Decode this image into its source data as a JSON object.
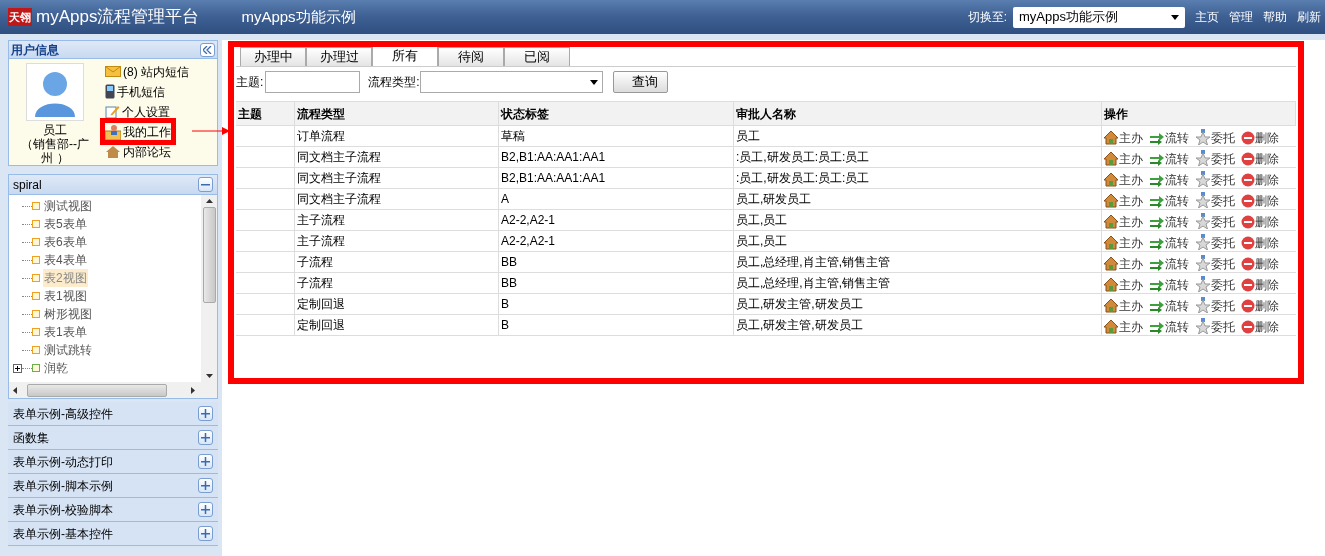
{
  "header": {
    "logo_mark": "天翎",
    "app_title": "myApps流程管理平台",
    "module_title": "myApps功能示例",
    "switch_label": "切换至:",
    "switch_value": "myApps功能示例",
    "links": [
      "主页",
      "管理",
      "帮助",
      "刷新"
    ]
  },
  "user_panel": {
    "title": "用户信息",
    "user_name": "员工",
    "user_dept": "（销售部--广州 ）",
    "links": [
      {
        "text": "(8) 站内短信",
        "kind": "mail",
        "highlighted": false
      },
      {
        "text": "手机短信",
        "kind": "phone",
        "highlighted": false
      },
      {
        "text": "个人设置",
        "kind": "settings",
        "highlighted": false
      },
      {
        "text": "我的工作",
        "kind": "work",
        "highlighted": true
      },
      {
        "text": "内部论坛",
        "kind": "forum",
        "highlighted": false
      }
    ]
  },
  "tree_panel": {
    "title": "spiral",
    "expanded": true,
    "items": [
      {
        "label": "测试视图",
        "selected": false
      },
      {
        "label": "表5表单",
        "selected": false
      },
      {
        "label": "表6表单",
        "selected": false
      },
      {
        "label": "表4表单",
        "selected": false
      },
      {
        "label": "表2视图",
        "selected": true
      },
      {
        "label": "表1视图",
        "selected": false
      },
      {
        "label": "树形视图",
        "selected": false
      },
      {
        "label": "表1表单",
        "selected": false
      },
      {
        "label": "测试跳转",
        "selected": false
      },
      {
        "label": "润乾",
        "selected": false,
        "expanded": false,
        "kind": "folder"
      }
    ]
  },
  "accordion": [
    {
      "title": "表单示例-高级控件",
      "expanded": false
    },
    {
      "title": "函数集",
      "expanded": false
    },
    {
      "title": "表单示例-动态打印",
      "expanded": false
    },
    {
      "title": "表单示例-脚本示例",
      "expanded": false
    },
    {
      "title": "表单示例-校验脚本",
      "expanded": false
    },
    {
      "title": "表单示例-基本控件",
      "expanded": false
    }
  ],
  "tabs": [
    {
      "label": "办理中",
      "selected": false
    },
    {
      "label": "办理过",
      "selected": false
    },
    {
      "label": "所有",
      "selected": true
    },
    {
      "label": "待阅",
      "selected": false
    },
    {
      "label": "已阅",
      "selected": false
    }
  ],
  "search": {
    "subject_label": "主题:",
    "type_label": "流程类型:",
    "button": "查询"
  },
  "table": {
    "columns": [
      "主题",
      "流程类型",
      "状态标签",
      "审批人名称",
      "操作"
    ],
    "rows": [
      {
        "type": "订单流程",
        "status": "草稿",
        "approvers": "员工",
        "actions": [
          {
            "label": "主办",
            "kind": "host"
          },
          {
            "label": "流转",
            "kind": "transfer"
          },
          {
            "label": "委托",
            "kind": "delegate"
          },
          {
            "label": "删除",
            "kind": "delete"
          }
        ]
      },
      {
        "type": "同文档主子流程",
        "status": "B2,B1:AA:AA1:AA1",
        "approvers": ":员工,研发员工:员工:员工",
        "actions": [
          {
            "label": "主办",
            "kind": "host"
          },
          {
            "label": "流转",
            "kind": "transfer"
          },
          {
            "label": "委托",
            "kind": "delegate"
          },
          {
            "label": "删除",
            "kind": "delete"
          }
        ]
      },
      {
        "type": "同文档主子流程",
        "status": "B2,B1:AA:AA1:AA1",
        "approvers": ":员工,研发员工:员工:员工",
        "actions": [
          {
            "label": "主办",
            "kind": "host"
          },
          {
            "label": "流转",
            "kind": "transfer"
          },
          {
            "label": "委托",
            "kind": "delegate"
          },
          {
            "label": "删除",
            "kind": "delete"
          }
        ]
      },
      {
        "type": "同文档主子流程",
        "status": "A",
        "approvers": "员工,研发员工",
        "actions": [
          {
            "label": "主办",
            "kind": "host"
          },
          {
            "label": "流转",
            "kind": "transfer"
          },
          {
            "label": "委托",
            "kind": "delegate"
          },
          {
            "label": "删除",
            "kind": "delete"
          }
        ]
      },
      {
        "type": "主子流程",
        "status": "A2-2,A2-1",
        "approvers": "员工,员工",
        "actions": [
          {
            "label": "主办",
            "kind": "host"
          },
          {
            "label": "流转",
            "kind": "transfer"
          },
          {
            "label": "委托",
            "kind": "delegate"
          },
          {
            "label": "删除",
            "kind": "delete"
          }
        ]
      },
      {
        "type": "主子流程",
        "status": "A2-2,A2-1",
        "approvers": "员工,员工",
        "actions": [
          {
            "label": "主办",
            "kind": "host"
          },
          {
            "label": "流转",
            "kind": "transfer"
          },
          {
            "label": "委托",
            "kind": "delegate"
          },
          {
            "label": "删除",
            "kind": "delete"
          }
        ]
      },
      {
        "type": "子流程",
        "status": "BB",
        "approvers": "员工,总经理,肖主管,销售主管",
        "actions": [
          {
            "label": "主办",
            "kind": "host"
          },
          {
            "label": "流转",
            "kind": "transfer"
          },
          {
            "label": "委托",
            "kind": "delegate"
          },
          {
            "label": "删除",
            "kind": "delete"
          }
        ]
      },
      {
        "type": "子流程",
        "status": "BB",
        "approvers": "员工,总经理,肖主管,销售主管",
        "actions": [
          {
            "label": "主办",
            "kind": "host"
          },
          {
            "label": "流转",
            "kind": "transfer"
          },
          {
            "label": "委托",
            "kind": "delegate"
          },
          {
            "label": "删除",
            "kind": "delete"
          }
        ]
      },
      {
        "type": "定制回退",
        "status": "B",
        "approvers": "员工,研发主管,研发员工",
        "actions": [
          {
            "label": "主办",
            "kind": "host"
          },
          {
            "label": "流转",
            "kind": "transfer"
          },
          {
            "label": "委托",
            "kind": "delegate"
          },
          {
            "label": "删除",
            "kind": "delete"
          }
        ]
      },
      {
        "type": "定制回退",
        "status": "B",
        "approvers": "员工,研发主管,研发员工",
        "actions": [
          {
            "label": "主办",
            "kind": "host"
          },
          {
            "label": "流转",
            "kind": "transfer"
          },
          {
            "label": "委托",
            "kind": "delegate"
          },
          {
            "label": "删除",
            "kind": "delete"
          }
        ]
      }
    ]
  }
}
